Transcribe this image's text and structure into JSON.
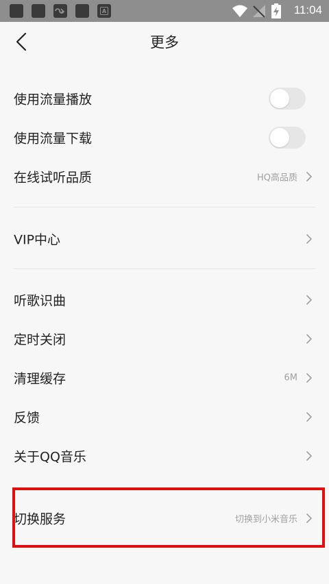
{
  "status_bar": {
    "time": "11:04",
    "left_icons": [
      "app-icon",
      "app-icon",
      "link-icon",
      "app-icon",
      "app-a-icon"
    ],
    "right_icons": [
      "wifi-icon",
      "no-signal-icon",
      "battery-charging-icon"
    ],
    "app_a_letter": "A"
  },
  "header": {
    "title": "更多",
    "back_icon": "chevron-left-icon"
  },
  "settings": {
    "mobile_play": {
      "label": "使用流量播放",
      "enabled": false
    },
    "mobile_download": {
      "label": "使用流量下载",
      "enabled": false
    },
    "online_quality": {
      "label": "在线试听品质",
      "value": "HQ高品质"
    },
    "vip_center": {
      "label": "VIP中心"
    },
    "song_recognition": {
      "label": "听歌识曲"
    },
    "sleep_timer": {
      "label": "定时关闭"
    },
    "clear_cache": {
      "label": "清理缓存",
      "value": "6M"
    },
    "feedback": {
      "label": "反馈"
    },
    "about": {
      "label": "关于QQ音乐"
    },
    "switch_service": {
      "label": "切换服务",
      "value": "切换到小米音乐"
    }
  },
  "colors": {
    "background": "#f7f7f7",
    "status_bar": "#8e8e8e",
    "highlight": "#e01010",
    "secondary_text": "#a0a0a0"
  }
}
